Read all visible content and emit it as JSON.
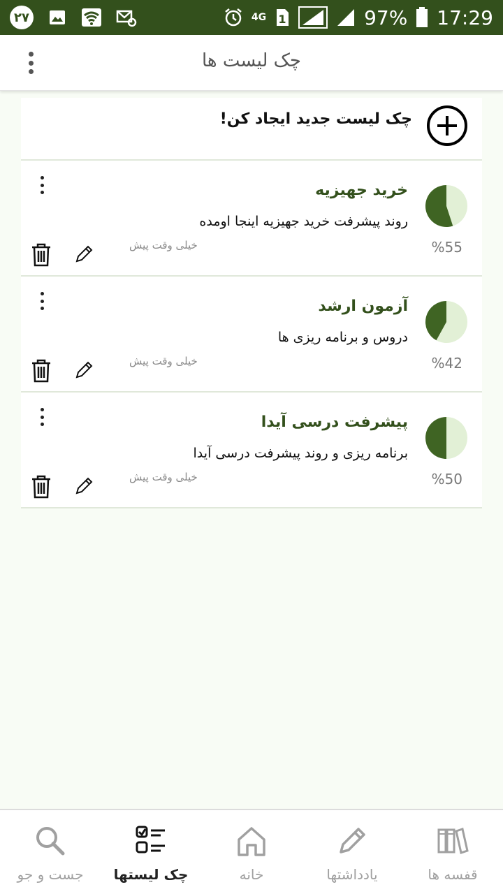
{
  "status_bar": {
    "notification_badge": "۲۷",
    "battery": "97%",
    "time": "17:29",
    "network": "4G"
  },
  "app_bar": {
    "title": "چک لیست ها"
  },
  "create": {
    "label": "چک لیست جدید ایجاد کن!"
  },
  "checklists": [
    {
      "title": "خرید جهیزیه",
      "description": "روند پیشرفت خرید جهیزیه اینجا اومده",
      "time": "خیلی وقت پیش",
      "percent_label": "%55",
      "progress": 0.55
    },
    {
      "title": "آزمون ارشد",
      "description": "دروس و برنامه ریزی ها",
      "time": "خیلی وقت پیش",
      "percent_label": "%42",
      "progress": 0.42
    },
    {
      "title": "پیشرفت درسی آیدا",
      "description": "برنامه ریزی و روند پیشرفت درسی آیدا",
      "time": "خیلی وقت پیش",
      "percent_label": "%50",
      "progress": 0.5
    }
  ],
  "bottom_nav": {
    "search": "جست و جو",
    "checklists": "چک لیستها",
    "home": "خانه",
    "notes": "یادداشتها",
    "shelves": "قفسه ها"
  },
  "colors": {
    "accent": "#33501c",
    "pie_bg": "#e2f0d6",
    "pie_fill": "#3f6423"
  }
}
